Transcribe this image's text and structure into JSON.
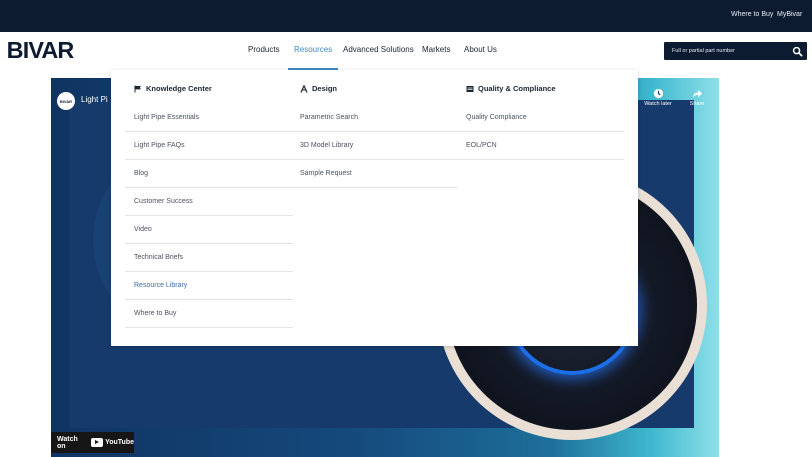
{
  "topbar": {
    "where_to_buy": "Where to Buy",
    "mybivar": "MyBivar"
  },
  "brand": {
    "logo_text": "BIVAR",
    "color": "#0d1b31"
  },
  "nav": {
    "items": [
      {
        "label": "Products"
      },
      {
        "label": "Resources"
      },
      {
        "label": "Advanced Solutions"
      },
      {
        "label": "Markets"
      },
      {
        "label": "About Us"
      }
    ],
    "active_color": "#3f8ac0"
  },
  "search": {
    "placeholder": "Full or partial part number"
  },
  "video": {
    "channel_badge": "BIVAR",
    "title": "Light Pi",
    "watch_later": "Watch later",
    "share": "Share",
    "watch_on": "Watch on",
    "youtube": "YouTube"
  },
  "mega_menu": {
    "columns": [
      {
        "heading": "Knowledge Center",
        "icon": "flag-icon",
        "items": [
          "Light Pipe Essentials",
          "Light Pipe FAQs",
          "Blog",
          "Customer Success",
          "Video",
          "Technical Briefs",
          "Resource Library",
          "Where to Buy"
        ]
      },
      {
        "heading": "Design",
        "icon": "design-tool-icon",
        "items": [
          "Parametric Search",
          "3D Model Library",
          "Sample Request"
        ]
      },
      {
        "heading": "Quality & Compliance",
        "icon": "certificate-icon",
        "items": [
          "Quality Compliance",
          "EOL/PCN"
        ]
      }
    ]
  }
}
